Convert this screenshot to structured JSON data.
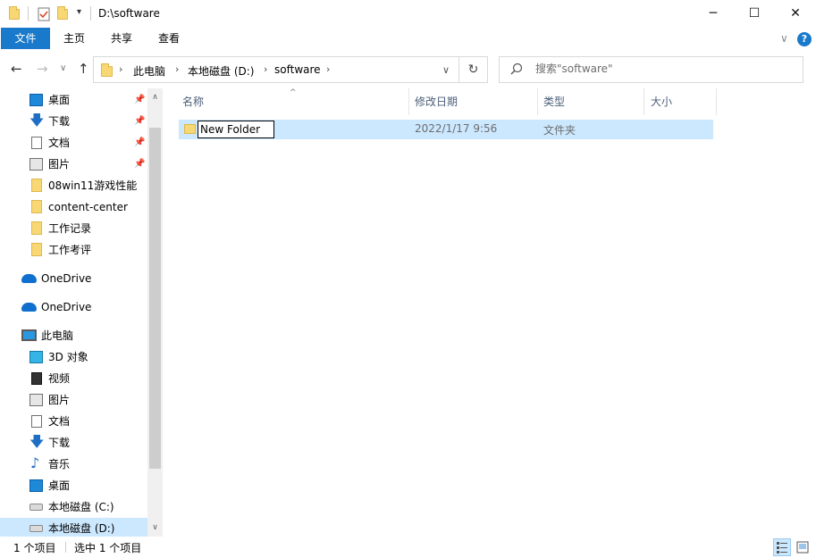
{
  "window": {
    "title": "D:\\software",
    "minimize": "─",
    "maximize": "☐",
    "close": "✕"
  },
  "ribbon": {
    "tabs": [
      "文件",
      "主页",
      "共享",
      "查看"
    ],
    "expand": "∨",
    "help": "?"
  },
  "nav": {
    "back": "←",
    "forward": "→",
    "recent": "∨",
    "up": "↑",
    "breadcrumb": [
      "此电脑",
      "本地磁盘 (D:)",
      "software"
    ],
    "dropdown": "∨",
    "refresh": "↻",
    "search_placeholder": "搜索\"software\""
  },
  "sidebar": {
    "quick_access": [
      {
        "label": "桌面",
        "icon": "desktop-icon",
        "pinned": true
      },
      {
        "label": "下载",
        "icon": "download-icon",
        "pinned": true
      },
      {
        "label": "文档",
        "icon": "document-icon",
        "pinned": true
      },
      {
        "label": "图片",
        "icon": "picture-icon",
        "pinned": true
      },
      {
        "label": "08win11游戏性能",
        "icon": "folder-icon",
        "pinned": false
      },
      {
        "label": "content-center",
        "icon": "folder-icon",
        "pinned": false
      },
      {
        "label": "工作记录",
        "icon": "folder-icon",
        "pinned": false
      },
      {
        "label": "工作考评",
        "icon": "folder-icon",
        "pinned": false
      }
    ],
    "onedrive": [
      "OneDrive",
      "OneDrive"
    ],
    "this_pc": "此电脑",
    "pc_items": [
      {
        "label": "3D 对象",
        "icon": "3d-objects-icon"
      },
      {
        "label": "视频",
        "icon": "video-icon"
      },
      {
        "label": "图片",
        "icon": "picture-icon"
      },
      {
        "label": "文档",
        "icon": "document-icon"
      },
      {
        "label": "下载",
        "icon": "download-icon"
      },
      {
        "label": "音乐",
        "icon": "music-icon"
      },
      {
        "label": "桌面",
        "icon": "desktop-icon"
      },
      {
        "label": "本地磁盘 (C:)",
        "icon": "drive-icon"
      },
      {
        "label": "本地磁盘 (D:)",
        "icon": "drive-icon"
      }
    ]
  },
  "columns": {
    "name": "名称",
    "modified": "修改日期",
    "type": "类型",
    "size": "大小"
  },
  "files": [
    {
      "name": "New Folder",
      "modified": "2022/1/17 9:56",
      "type": "文件夹",
      "size": ""
    }
  ],
  "status": {
    "count": "1 个项目",
    "selected": "选中 1 个项目"
  },
  "colors": {
    "accent": "#1979ca",
    "selection": "#cce8ff",
    "folder": "#f8d775"
  }
}
